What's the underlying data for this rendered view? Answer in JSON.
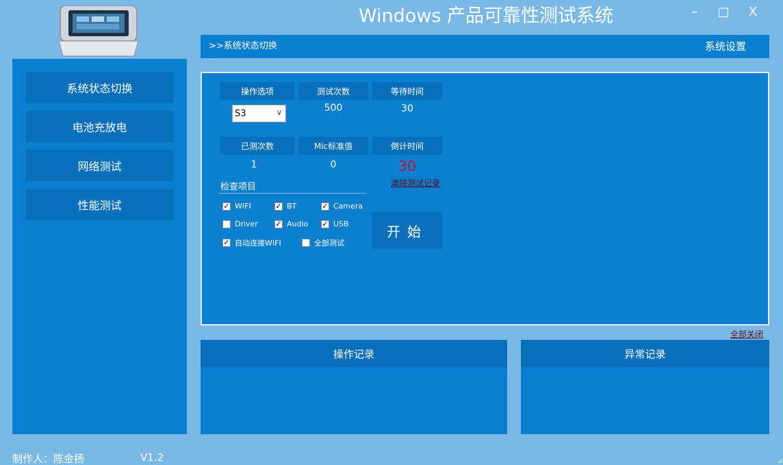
{
  "window": {
    "title": "Windows 产品可靠性测试系统",
    "minimize": "–",
    "maximize": "□",
    "close": "X"
  },
  "sidebar": {
    "items": [
      {
        "label": "系统状态切换"
      },
      {
        "label": "电池充放电"
      },
      {
        "label": "网络测试"
      },
      {
        "label": "性能测试"
      }
    ]
  },
  "breadcrumb": {
    "text": ">>系统状态切换",
    "settings": "系统设置"
  },
  "panel": {
    "op_label": "操作选项",
    "op_value": "S3",
    "count_label": "测试次数",
    "count_value": "500",
    "wait_label": "等待时间",
    "wait_value": "30",
    "tested_label": "已测次数",
    "tested_value": "1",
    "mic_label": "Mic标准值",
    "mic_value": "0",
    "countdown_label": "倒计时间",
    "countdown_value": "30",
    "clear_link": "清除测试记录",
    "check_title": "检查项目",
    "checks": [
      {
        "label": "WIFI",
        "checked": true
      },
      {
        "label": "BT",
        "checked": true
      },
      {
        "label": "Camera",
        "checked": true
      },
      {
        "label": "Driver",
        "checked": false
      },
      {
        "label": "Audio",
        "checked": true
      },
      {
        "label": "USB",
        "checked": true
      },
      {
        "label": "自动连接WIFI",
        "checked": true
      },
      {
        "label": "全部测试",
        "checked": false
      }
    ],
    "start": "开始"
  },
  "close_all": "全部关闭",
  "logs": {
    "ops_title": "操作记录",
    "errors_title": "异常记录"
  },
  "footer": {
    "author": "制作人：陈金扬",
    "version": "V1.2"
  },
  "colors": {
    "background": "#7ab8e6",
    "panel": "#0a7fd0",
    "button": "#086fba",
    "countdown": "#c8102e"
  }
}
